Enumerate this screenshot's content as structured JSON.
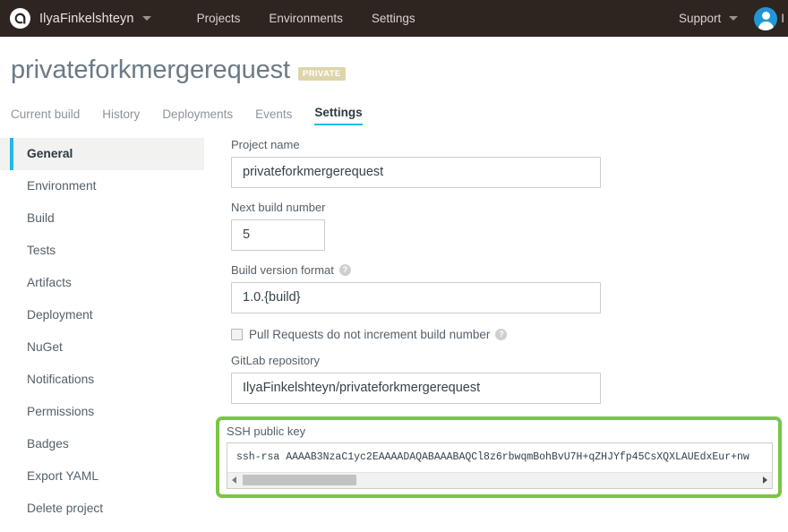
{
  "topnav": {
    "logo_icon": "appveyor-logo-icon",
    "account_name": "IlyaFinkelshteyn",
    "account_caret_icon": "chevron-down-icon",
    "links": [
      {
        "label": "Projects"
      },
      {
        "label": "Environments"
      },
      {
        "label": "Settings"
      }
    ],
    "support_label": "Support",
    "support_caret_icon": "chevron-down-icon",
    "avatar_icon": "user-avatar-icon",
    "edge_label": "I"
  },
  "page": {
    "title": "privateforkmergerequest",
    "badge": "PRIVATE"
  },
  "tabs": [
    {
      "label": "Current build",
      "active": false
    },
    {
      "label": "History",
      "active": false
    },
    {
      "label": "Deployments",
      "active": false
    },
    {
      "label": "Events",
      "active": false
    },
    {
      "label": "Settings",
      "active": true
    }
  ],
  "sidebar": {
    "items": [
      {
        "label": "General",
        "active": true
      },
      {
        "label": "Environment",
        "active": false
      },
      {
        "label": "Build",
        "active": false
      },
      {
        "label": "Tests",
        "active": false
      },
      {
        "label": "Artifacts",
        "active": false
      },
      {
        "label": "Deployment",
        "active": false
      },
      {
        "label": "NuGet",
        "active": false
      },
      {
        "label": "Notifications",
        "active": false
      },
      {
        "label": "Permissions",
        "active": false
      },
      {
        "label": "Badges",
        "active": false
      },
      {
        "label": "Export YAML",
        "active": false
      },
      {
        "label": "Delete project",
        "active": false
      }
    ]
  },
  "form": {
    "project_name": {
      "label": "Project name",
      "value": "privateforkmergerequest"
    },
    "next_build_number": {
      "label": "Next build number",
      "value": "5"
    },
    "build_version_format": {
      "label": "Build version format",
      "help_icon": "question-mark-icon",
      "help_glyph": "?",
      "value": "1.0.{build}"
    },
    "pull_requests_checkbox": {
      "label": "Pull Requests do not increment build number",
      "checked": false,
      "help_icon": "question-mark-icon",
      "help_glyph": "?"
    },
    "gitlab_repository": {
      "label": "GitLab repository",
      "value": "IlyaFinkelshteyn/privateforkmergerequest"
    },
    "ssh_public_key": {
      "label": "SSH public key",
      "value": "ssh-rsa AAAAB3NzaC1yc2EAAAADAQABAAABAQCl8z6rbwqmBohBvU7H+qZHJYfp45CsXQXLAUEdxEur+nw",
      "scroll_left_icon": "scroll-left-arrow-icon",
      "scroll_right_icon": "scroll-right-arrow-icon",
      "highlight_color": "#7cc543"
    }
  },
  "colors": {
    "nav_background": "#2e2420",
    "accent": "#24b8e8",
    "badge_background": "#ddd5ab",
    "highlight_border": "#7cc543",
    "avatar_background": "#2196d6"
  }
}
